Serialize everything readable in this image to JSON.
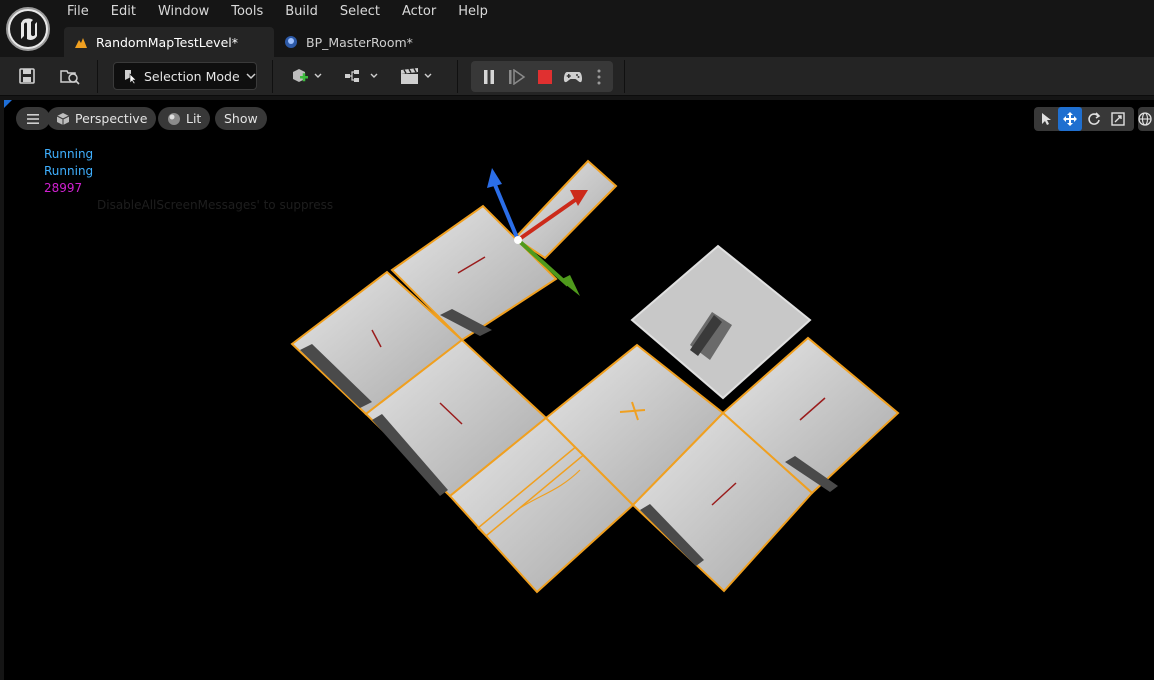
{
  "menu": {
    "items": [
      "File",
      "Edit",
      "Window",
      "Tools",
      "Build",
      "Select",
      "Actor",
      "Help"
    ]
  },
  "tabs": [
    {
      "label": "RandomMapTestLevel*",
      "icon": "level-icon"
    },
    {
      "label": "BP_MasterRoom*",
      "icon": "blueprint-icon"
    }
  ],
  "toolbar": {
    "selection_mode_label": "Selection Mode",
    "icons": [
      "save-icon",
      "content-browser-icon",
      "selection-mode-icon",
      "add-actor-icon",
      "blueprint-graph-icon",
      "cinematics-icon",
      "pause-icon",
      "skip-frame-icon",
      "stop-icon",
      "possess-icon",
      "more-options-icon"
    ]
  },
  "viewport": {
    "perspective_label": "Perspective",
    "lit_label": "Lit",
    "show_label": "Show",
    "debug_lines": [
      {
        "text": "Running",
        "color": "#3fb0ff"
      },
      {
        "text": "Running",
        "color": "#3fb0ff"
      },
      {
        "text": "28997",
        "color": "#d020d0"
      }
    ],
    "faint_message": "DisableAllScreenMessages' to suppress"
  },
  "colors": {
    "accent_blue": "#1f6fd0",
    "selection_orange": "#f0a020",
    "stop_red": "#e03030"
  }
}
